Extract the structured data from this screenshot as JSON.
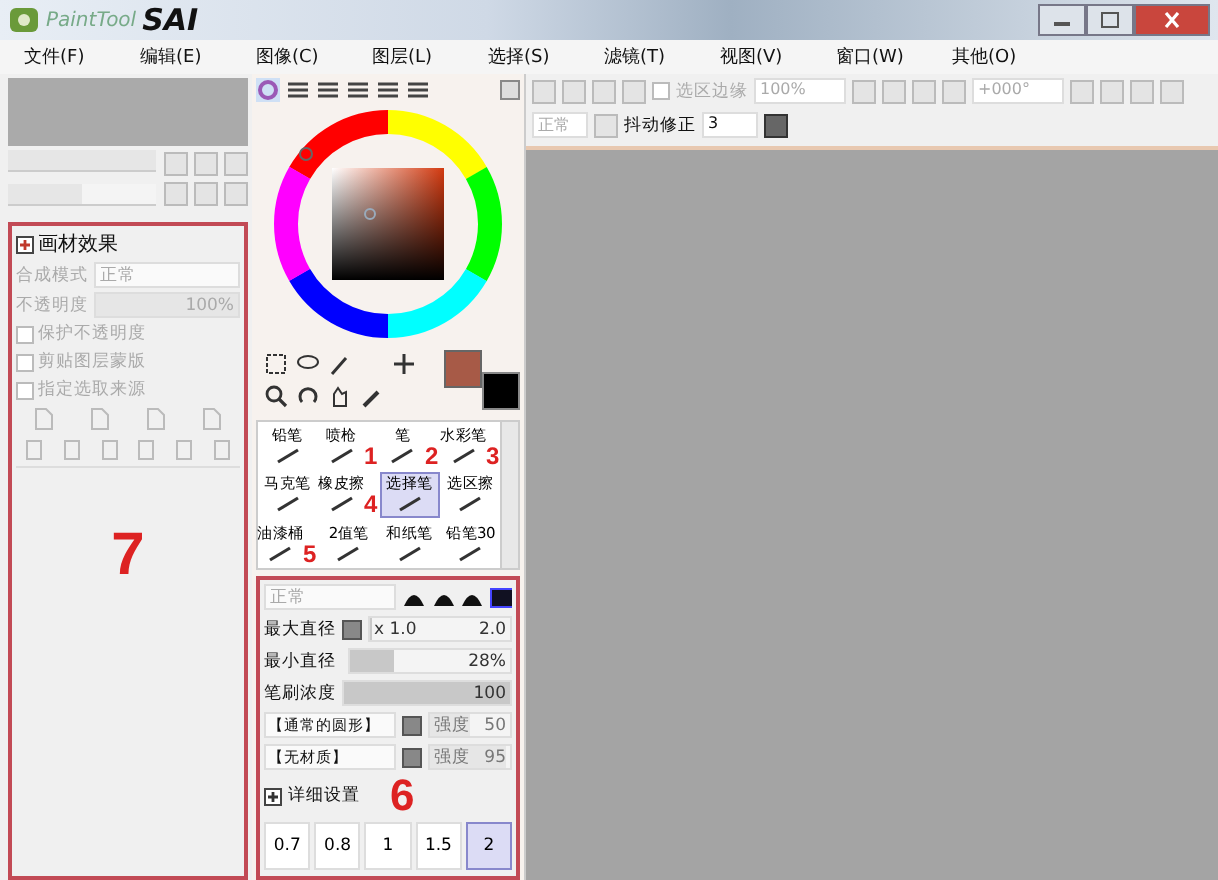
{
  "window": {
    "title_logo": "PaintTool",
    "title_name": "SAI"
  },
  "menu": [
    "文件(F)",
    "编辑(E)",
    "图像(C)",
    "图层(L)",
    "选择(S)",
    "滤镜(T)",
    "视图(V)",
    "窗口(W)",
    "其他(O)"
  ],
  "navigator": {
    "zoom_slider": {
      "level": 1.0
    },
    "rotate_slider": {
      "level": 0.5
    }
  },
  "layer_panel": {
    "title": "画材效果",
    "blend_label": "合成模式",
    "blend_value": "正常",
    "opacity_label": "不透明度",
    "opacity": {
      "value": "100%",
      "level": 1.0
    },
    "options": [
      {
        "label": "保护不透明度",
        "checked": false
      },
      {
        "label": "剪贴图层蒙版",
        "checked": false
      },
      {
        "label": "指定选取来源",
        "checked": false
      }
    ],
    "annotation": "7"
  },
  "toolbar": {
    "selection_edge": {
      "label": "选区边缘",
      "checked": false
    },
    "zoom": "100%",
    "angle": "+000°",
    "mode": "正常",
    "stabilizer_label": "抖动修正",
    "stabilizer_value": "3"
  },
  "tools": [
    {
      "label": "铅笔",
      "selected": false
    },
    {
      "label": "喷枪",
      "selected": false,
      "annotation": "1"
    },
    {
      "label": "笔",
      "selected": false,
      "annotation": "2"
    },
    {
      "label": "水彩笔",
      "selected": false,
      "annotation": "3"
    },
    {
      "label": "马克笔",
      "selected": false
    },
    {
      "label": "橡皮擦",
      "selected": false,
      "annotation": "4"
    },
    {
      "label": "选择笔",
      "selected": true
    },
    {
      "label": "选区擦",
      "selected": false
    },
    {
      "label": "油漆桶",
      "selected": false,
      "annotation": "5"
    },
    {
      "label": "2值笔",
      "selected": false
    },
    {
      "label": "和纸笔",
      "selected": false
    },
    {
      "label": "铅笔30",
      "selected": false
    }
  ],
  "brush": {
    "mode": "正常",
    "max_size": {
      "label": "最大直径",
      "scale": "x 1.0",
      "value": "2.0",
      "level": 0.02
    },
    "min_size": {
      "label": "最小直径",
      "value": "28%",
      "level": 0.28
    },
    "density": {
      "label": "笔刷浓度",
      "value": "100",
      "level": 1.0
    },
    "shape": {
      "name": "【通常的圆形】",
      "strength_label": "强度",
      "strength": "50",
      "level": 0.5
    },
    "texture": {
      "name": "【无材质】",
      "strength_label": "强度",
      "strength": "95",
      "level": 0.95
    },
    "advanced": "详细设置",
    "annotation": "6",
    "sizes": [
      {
        "label": "0.7",
        "selected": false
      },
      {
        "label": "0.8",
        "selected": false
      },
      {
        "label": "1",
        "selected": false
      },
      {
        "label": "1.5",
        "selected": false
      },
      {
        "label": "2",
        "selected": true
      }
    ]
  }
}
